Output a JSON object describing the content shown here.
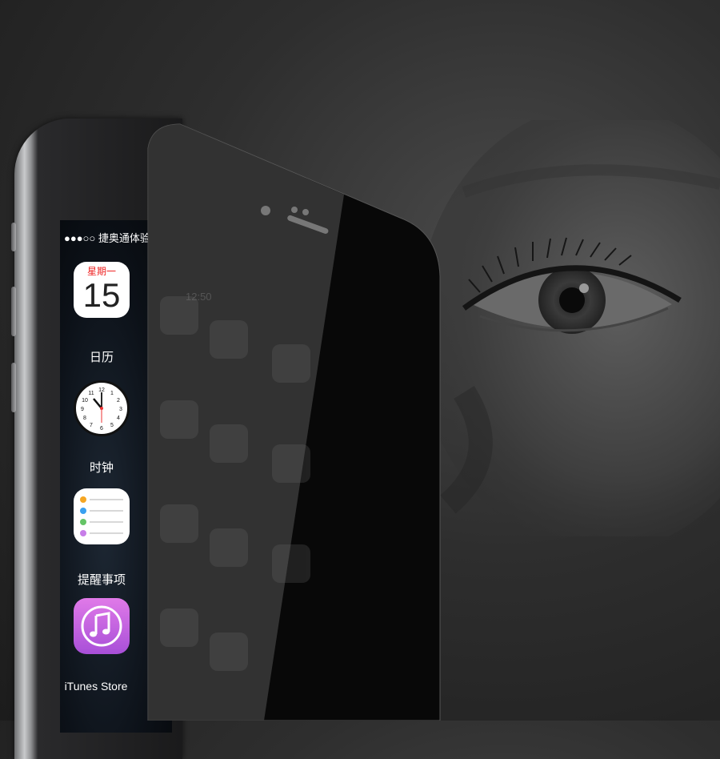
{
  "status_bar": {
    "signal": "●●●○○",
    "carrier": "捷奥通体验"
  },
  "apps": [
    {
      "name": "calendar",
      "label": "日历",
      "icon": "calendar-icon",
      "weekday": "星期一",
      "date": "15"
    },
    {
      "name": "clock",
      "label": "时钟",
      "icon": "clock-icon"
    },
    {
      "name": "reminders",
      "label": "提醒事项",
      "icon": "reminders-icon"
    },
    {
      "name": "itunes",
      "label": "iTunes Store",
      "icon": "music-note-icon"
    }
  ],
  "glass": {
    "ghost_time": "12:50"
  },
  "colors": {
    "background": "#2e2e2e",
    "glass": "#0a0a0a",
    "itunes": "#c25ee0"
  }
}
